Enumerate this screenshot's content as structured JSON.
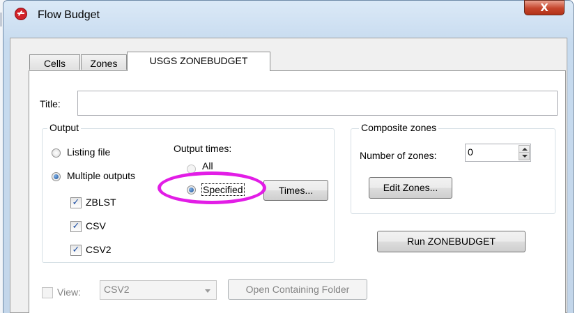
{
  "window": {
    "title": "Flow Budget",
    "close_label": "X",
    "app_icon": "flow-budget-logo-icon",
    "close_color": "#c5452c"
  },
  "tabs": [
    {
      "label": "Cells",
      "active": false
    },
    {
      "label": "Zones",
      "active": false
    },
    {
      "label": "USGS ZONEBUDGET",
      "active": true
    }
  ],
  "title_field": {
    "label": "Title:",
    "value": ""
  },
  "output": {
    "group_label": "Output",
    "listing_file_label": "Listing file",
    "listing_file_selected": false,
    "multiple_outputs_label": "Multiple outputs",
    "multiple_outputs_selected": true,
    "checks": [
      {
        "label": "ZBLST",
        "checked": true
      },
      {
        "label": "CSV",
        "checked": true
      },
      {
        "label": "CSV2",
        "checked": true
      }
    ],
    "output_times_label": "Output times:",
    "all_label": "All",
    "all_selected": false,
    "specified_label": "Specified",
    "specified_selected": true,
    "times_button": "Times..."
  },
  "composite": {
    "group_label": "Composite zones",
    "number_label": "Number of zones:",
    "number_value": "0",
    "edit_button": "Edit Zones..."
  },
  "run_button": "Run ZONEBUDGET",
  "view": {
    "checkbox_label": "View:",
    "checked": false,
    "selected": "CSV2",
    "open_folder_button": "Open Containing Folder"
  },
  "colors": {
    "highlight": "#e21de6",
    "radio_selected": "#1c4f94"
  }
}
